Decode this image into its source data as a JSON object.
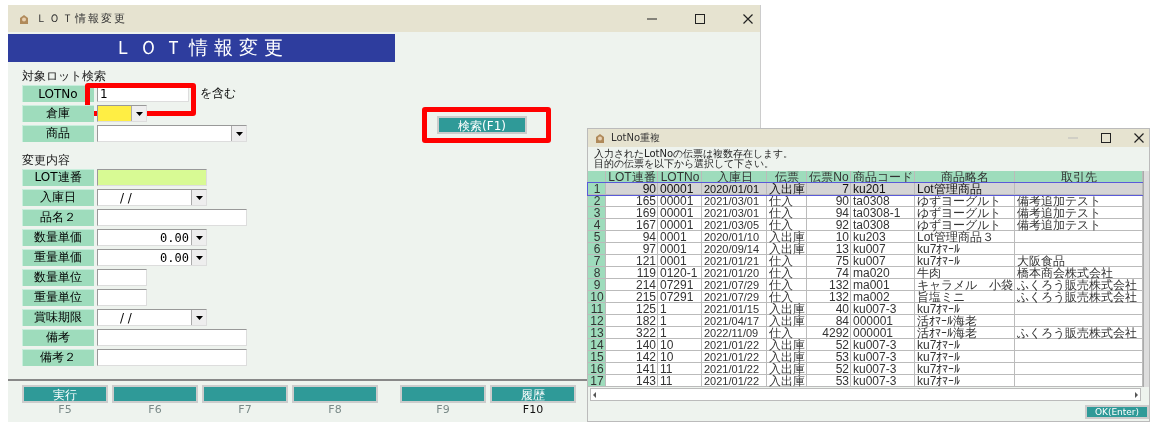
{
  "window": {
    "title": "ＬＯＴ情報変更",
    "header": "ＬＯＴ情報変更"
  },
  "search": {
    "heading": "対象ロット検索",
    "fields": [
      {
        "label": "LOTNo",
        "kind": "text",
        "value": "1",
        "suffix": "を含む",
        "highlighted": true
      },
      {
        "label": "倉庫",
        "kind": "combo",
        "focused": true
      },
      {
        "label": "商品",
        "kind": "combo"
      }
    ],
    "button": {
      "label": "検索(F1)",
      "highlighted": true
    }
  },
  "changes": {
    "heading": "変更内容",
    "fields": [
      {
        "label": "LOT連番",
        "kind": "display"
      },
      {
        "label": "入庫日",
        "kind": "combo",
        "value": "/  /"
      },
      {
        "label": "品名２",
        "kind": "text"
      },
      {
        "label": "数量単価",
        "kind": "number",
        "value": "0.00"
      },
      {
        "label": "重量単価",
        "kind": "number",
        "value": "0.00"
      },
      {
        "label": "数量単位",
        "kind": "text"
      },
      {
        "label": "重量単位",
        "kind": "text"
      },
      {
        "label": "賞味期限",
        "kind": "combo",
        "value": "/  /"
      },
      {
        "label": "備考",
        "kind": "text"
      },
      {
        "label": "備考２",
        "kind": "text"
      }
    ]
  },
  "function_keys": [
    {
      "label": "実行",
      "key": "F5",
      "emphasized": false
    },
    {
      "key": "F6",
      "emphasized": false
    },
    {
      "key": "F7",
      "emphasized": false
    },
    {
      "key": "F8",
      "emphasized": false
    },
    {
      "key": "F9",
      "emphasized": false
    },
    {
      "label": "履歴",
      "key": "F10",
      "emphasized": true
    }
  ],
  "dialog": {
    "title": "LotNo重複",
    "message": [
      "入力されたLotNoの伝票は複数存在します。",
      "目的の伝票を以下から選択して下さい。"
    ],
    "columns": [
      "LOT連番",
      "LOTNo",
      "入庫日",
      "伝票",
      "伝票No",
      "商品コード",
      "商品略名",
      "取引先"
    ],
    "rows": [
      {
        "num": "1",
        "selected": true,
        "cells": [
          "90",
          "00001",
          "2020/01/01",
          "入出庫",
          "7",
          "ku201",
          "Lot管理商品",
          null
        ]
      },
      {
        "num": "2",
        "selected": false,
        "cells": [
          "165",
          "00001",
          "2021/03/01",
          "仕入",
          "90",
          "ta0308",
          "ゆずヨーグルト",
          "備考追加テスト"
        ]
      },
      {
        "num": "3",
        "selected": false,
        "cells": [
          "169",
          "00001",
          "2021/03/01",
          "仕入",
          "94",
          "ta0308-1",
          "ゆずヨーグルト",
          "備考追加テスト"
        ]
      },
      {
        "num": "4",
        "selected": false,
        "cells": [
          "167",
          "00001",
          "2021/03/05",
          "仕入",
          "92",
          "ta0308",
          "ゆずヨーグルト",
          "備考追加テスト"
        ]
      },
      {
        "num": "5",
        "selected": false,
        "cells": [
          "94",
          "0001",
          "2020/01/10",
          "入出庫",
          "10",
          "ku203",
          "Lot管理商品３",
          null
        ]
      },
      {
        "num": "6",
        "selected": false,
        "cells": [
          "97",
          "0001",
          "2020/09/14",
          "入出庫",
          "13",
          "ku007",
          "ku7ｵﾏｰﾙ",
          null
        ]
      },
      {
        "num": "7",
        "selected": false,
        "cells": [
          "121",
          "0001",
          "2021/01/21",
          "仕入",
          "75",
          "ku007",
          "ku7ｵﾏｰﾙ",
          "大阪食品"
        ]
      },
      {
        "num": "8",
        "selected": false,
        "cells": [
          "119",
          "0120-1",
          "2021/01/20",
          "仕入",
          "74",
          "ma020",
          "牛肉",
          "橋本商会株式会社"
        ]
      },
      {
        "num": "9",
        "selected": false,
        "cells": [
          "214",
          "07291",
          "2021/07/29",
          "仕入",
          "132",
          "ma001",
          "キャラメル　小袋",
          "ふくろう販売株式会社"
        ]
      },
      {
        "num": "10",
        "selected": false,
        "cells": [
          "215",
          "07291",
          "2021/07/29",
          "仕入",
          "132",
          "ma002",
          "旨塩ミニ",
          "ふくろう販売株式会社"
        ]
      },
      {
        "num": "11",
        "selected": false,
        "cells": [
          "125",
          "1",
          "2021/01/15",
          "入出庫",
          "40",
          "ku007-3",
          "ku7ｵﾏｰﾙ",
          null
        ]
      },
      {
        "num": "12",
        "selected": false,
        "cells": [
          "182",
          "1",
          "2021/04/17",
          "入出庫",
          "84",
          "000001",
          "活ｵﾏｰﾙ海老",
          null
        ]
      },
      {
        "num": "13",
        "selected": false,
        "cells": [
          "322",
          "1",
          "2022/11/09",
          "仕入",
          "4292",
          "000001",
          "活ｵﾏｰﾙ海老",
          "ふくろう販売株式会社"
        ]
      },
      {
        "num": "14",
        "selected": false,
        "cells": [
          "140",
          "10",
          "2021/01/22",
          "入出庫",
          "52",
          "ku007-3",
          "ku7ｵﾏｰﾙ",
          null
        ]
      },
      {
        "num": "15",
        "selected": false,
        "cells": [
          "142",
          "10",
          "2021/01/22",
          "入出庫",
          "53",
          "ku007-3",
          "ku7ｵﾏｰﾙ",
          null
        ]
      },
      {
        "num": "16",
        "selected": false,
        "cells": [
          "141",
          "11",
          "2021/01/22",
          "入出庫",
          "52",
          "ku007-3",
          "ku7ｵﾏｰﾙ",
          null
        ]
      },
      {
        "num": "17",
        "selected": false,
        "cells": [
          "143",
          "11",
          "2021/01/22",
          "入出庫",
          "53",
          "ku007-3",
          "ku7ｵﾏｰﾙ",
          null
        ]
      }
    ],
    "ok_button": "OK(Enter)"
  }
}
